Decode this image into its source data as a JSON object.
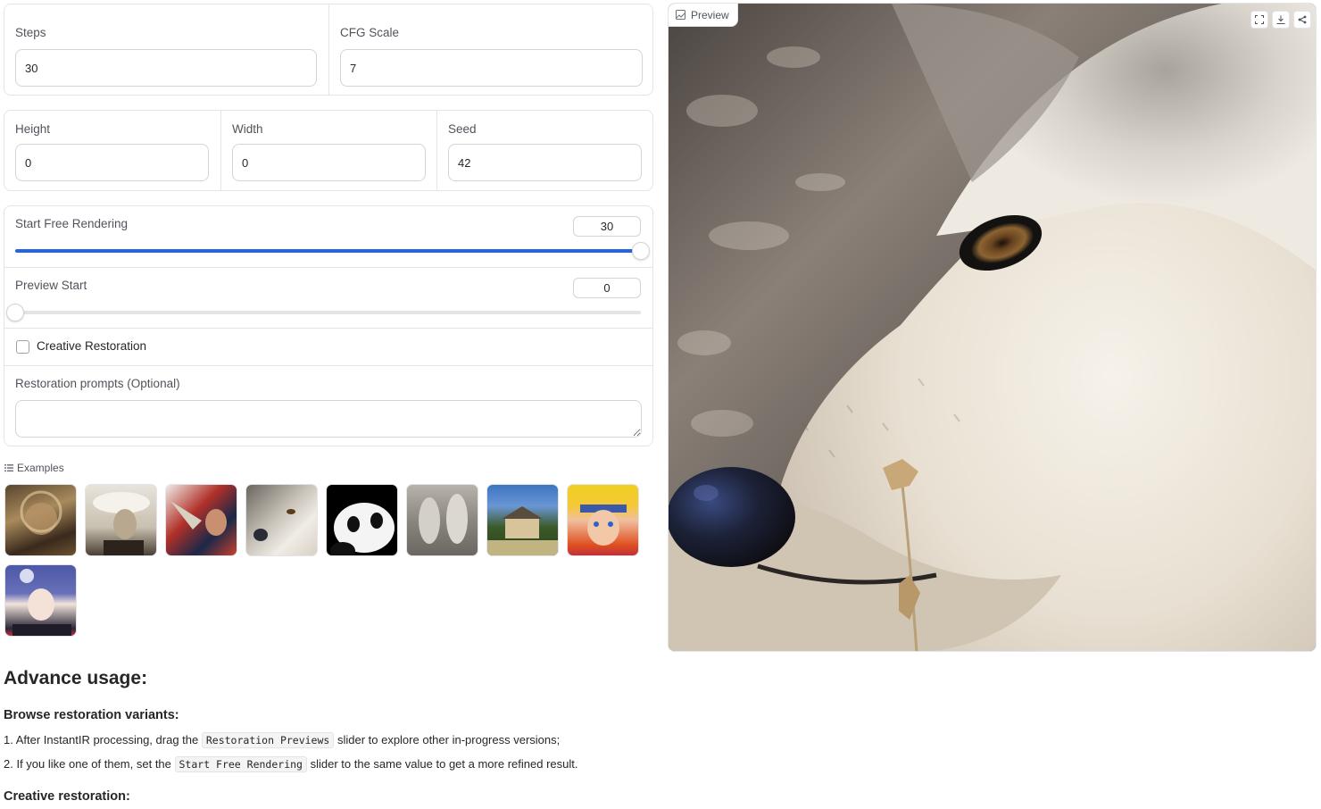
{
  "steps": {
    "label": "Steps",
    "value": "30"
  },
  "cfg_scale": {
    "label": "CFG Scale",
    "value": "7"
  },
  "height": {
    "label": "Height",
    "value": "0"
  },
  "width": {
    "label": "Width",
    "value": "0"
  },
  "seed": {
    "label": "Seed",
    "value": "42"
  },
  "start_free_rendering": {
    "label": "Start Free Rendering",
    "value": "30",
    "fill_fraction": 1.0
  },
  "preview_start": {
    "label": "Preview Start",
    "value": "0",
    "fill_fraction": 0.0
  },
  "creative_restoration": {
    "label": "Creative Restoration",
    "checked": false
  },
  "restoration_prompts": {
    "label": "Restoration prompts (Optional)",
    "value": ""
  },
  "examples": {
    "label": "Examples",
    "icon": "list-icon",
    "items": [
      "monkey-king",
      "vintage-woman",
      "trumpet-player",
      "wolf",
      "panda",
      "statues",
      "house",
      "naruto",
      "konan"
    ]
  },
  "preview": {
    "label": "Preview",
    "icon": "image-icon",
    "actions": [
      "fullscreen-icon",
      "download-icon",
      "share-icon"
    ]
  },
  "docs": {
    "heading": "Advance usage:",
    "browse_heading": "Browse restoration variants:",
    "step1_a": "1. After InstantIR processing, drag the ",
    "step1_code": "Restoration Previews",
    "step1_b": " slider to explore other in-progress versions;",
    "step2_a": "2. If you like one of them, set the ",
    "step2_code": "Start Free Rendering",
    "step2_b": " slider to the same value to get a more refined result.",
    "creative_heading": "Creative restoration:"
  },
  "colors": {
    "accent": "#2563eb",
    "border": "#e4e4e7"
  }
}
